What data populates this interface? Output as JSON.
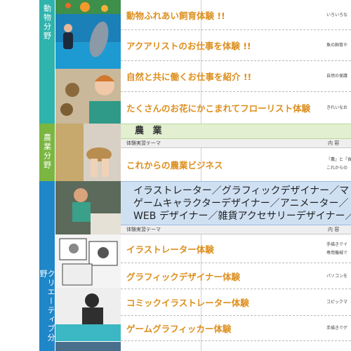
{
  "categories": {
    "animal": "動物分野",
    "agriculture": "農業分野",
    "creative": "クリエーティブ分野"
  },
  "agriculture_section": {
    "title": "農 業"
  },
  "creative_section": {
    "lines": [
      "イラストレーター／グラフィックデザイナー／マ",
      "ゲームキャラクターデザイナー／アニメーター／",
      "WEB デザイナー／雑貨アクセサリーデザイナー／"
    ]
  },
  "column_headers": {
    "theme": "体験実習テーマ",
    "content": "内 容"
  },
  "animal_rows": [
    {
      "theme": "動物ふれあい飼育体験 !!",
      "desc": "いろいろな"
    },
    {
      "theme": "アクアリストのお仕事を体験 !!",
      "desc": "魚の飼育や"
    },
    {
      "theme": "自然と共に働くお仕事を紹介 !!",
      "desc": "自然の保護"
    },
    {
      "theme": "たくさんのお花にかこまれてフローリスト体験",
      "desc": "きれいなお"
    }
  ],
  "agri_rows": [
    {
      "theme": "これからの農業ビジネス",
      "desc": "『農』と『食",
      "desc2": "これからの"
    }
  ],
  "creative_rows": [
    {
      "theme": "イラストレーター体験",
      "desc": "手描きでイ",
      "desc2": "専用機械で"
    },
    {
      "theme": "グラフィックデザイナー体験",
      "desc": "パソコンを"
    },
    {
      "theme": "コミックイラストレーター体験",
      "desc": "コピックマ"
    },
    {
      "theme": "ゲームグラフィッカー体験",
      "desc": "手描きでゲ"
    }
  ]
}
